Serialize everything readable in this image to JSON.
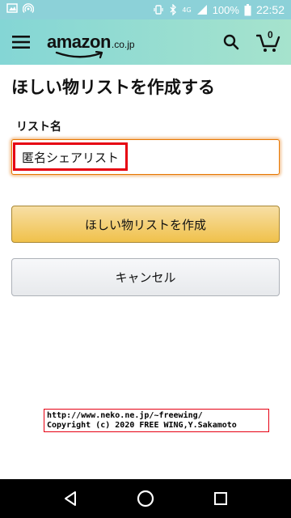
{
  "status_bar": {
    "signal_label": "4G",
    "battery_percent": "100%",
    "time": "22:52"
  },
  "header": {
    "logo_text": "amazon",
    "logo_suffix": ".co.jp",
    "cart_count": "0",
    "icons": [
      "menu-icon",
      "search-icon",
      "cart-icon"
    ]
  },
  "page": {
    "title": "ほしい物リストを作成する",
    "field_label": "リスト名",
    "list_name_value": "匿名シェアリスト",
    "create_button": "ほしい物リストを作成",
    "cancel_button": "キャンセル"
  },
  "copyright": {
    "line1": "http://www.neko.ne.jp/~freewing/",
    "line2": "Copyright (c) 2020 FREE WING,Y.Sakamoto"
  },
  "nav": {
    "icons": [
      "back-icon",
      "home-icon",
      "recents-icon"
    ]
  },
  "colors": {
    "header_gradient_start": "#84d6d5",
    "header_gradient_end": "#a6e3cd",
    "input_focus": "#e77600",
    "highlight_red": "#e60012",
    "create_button": "#f0c14b",
    "cancel_button": "#e7e9ec"
  }
}
